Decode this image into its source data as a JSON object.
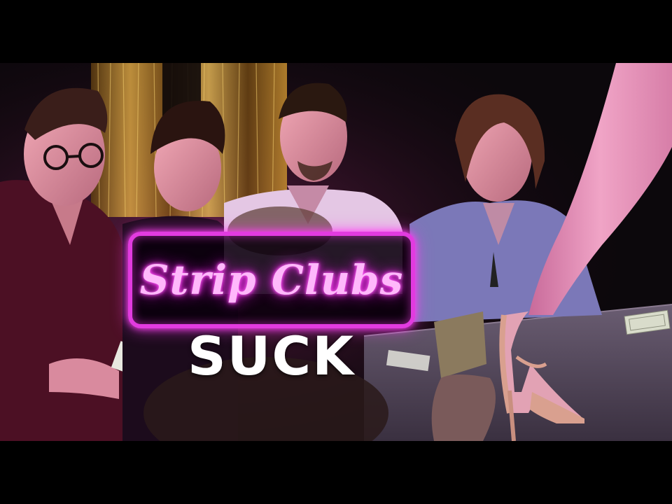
{
  "thumbnail": {
    "title_neon": "Strip Clubs",
    "title_sub": "SUCK"
  },
  "colors": {
    "neon_pink": "#e23be0",
    "neon_glow": "#ff2ef4",
    "background": "#000000",
    "gold_tinsel": "#c8902a"
  },
  "scene": {
    "people": [
      "man-with-glasses",
      "man-curly-hair",
      "man-center-back",
      "man-long-hair",
      "dancer-leg"
    ],
    "props": [
      "gold-tinsel-curtain",
      "stage",
      "dollar-bill",
      "dollar-bill-in-hand",
      "high-heel-shoe"
    ]
  }
}
